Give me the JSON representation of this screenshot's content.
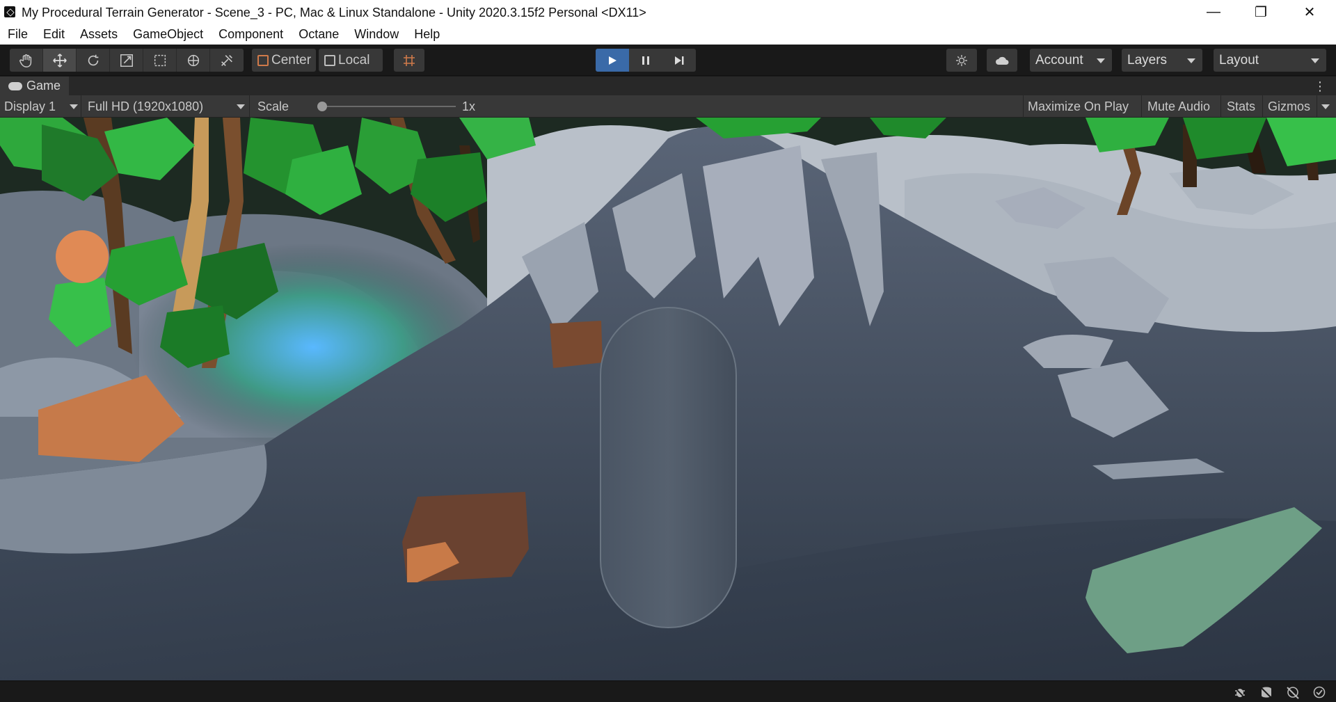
{
  "window": {
    "title": "My Procedural Terrain Generator - Scene_3 - PC, Mac & Linux Standalone - Unity 2020.3.15f2 Personal <DX11>",
    "minimize": "—",
    "restore": "❐",
    "close": "✕"
  },
  "menu": [
    "File",
    "Edit",
    "Assets",
    "GameObject",
    "Component",
    "Octane",
    "Window",
    "Help"
  ],
  "toolbar": {
    "tools": [
      "hand-tool-icon",
      "move-tool-icon",
      "rotate-tool-icon",
      "scale-tool-icon",
      "rect-tool-icon",
      "transform-tool-icon",
      "custom-tool-icon"
    ],
    "pivot_mode": "Center",
    "pivot_rotation": "Local",
    "account": "Account",
    "layers": "Layers",
    "layout": "Layout"
  },
  "game_tab": {
    "label": "Game"
  },
  "game_bar": {
    "display": "Display 1",
    "resolution": "Full HD (1920x1080)",
    "scale_label": "Scale",
    "scale_value": "1x",
    "maximize_on_play": "Maximize On Play",
    "mute_audio": "Mute Audio",
    "stats": "Stats",
    "gizmos": "Gizmos"
  },
  "colors": {
    "play_active": "#3a6aa8",
    "terrain_shadow": "#3b4556",
    "terrain_light": "#9aa3b0",
    "foliage": "#2fa83a"
  }
}
